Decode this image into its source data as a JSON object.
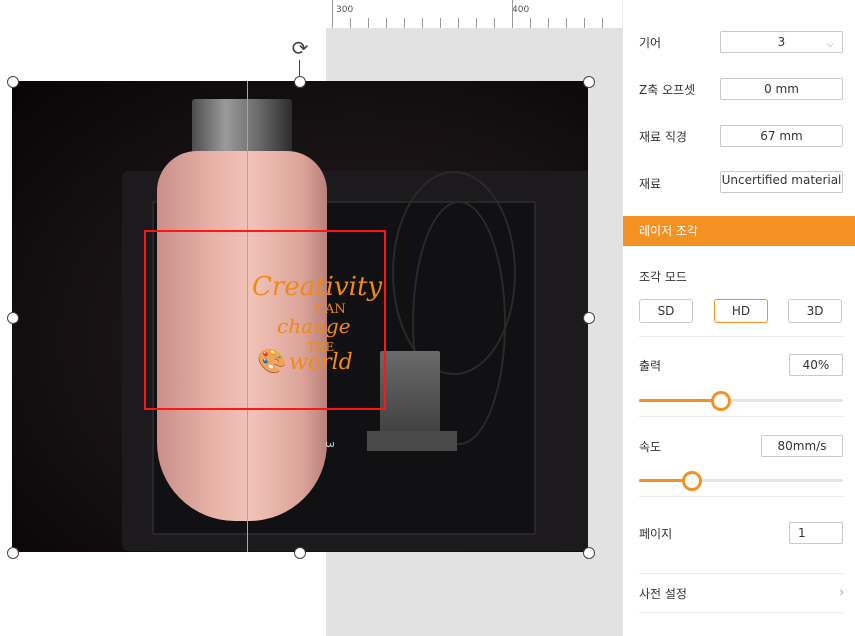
{
  "ruler": {
    "labels": [
      "300",
      "400"
    ]
  },
  "panel": {
    "gear": {
      "label": "기어",
      "value": "3"
    },
    "z_offset": {
      "label": "Z축 오프셋",
      "value": "0 mm"
    },
    "material_diameter": {
      "label": "재료 직경",
      "value": "67 mm"
    },
    "material": {
      "label": "재료",
      "value": "Uncertified material"
    },
    "section": {
      "title": "레이저 조각"
    },
    "engrave_mode": {
      "label": "조각 모드",
      "options": [
        "SD",
        "HD",
        "3D"
      ],
      "selected": "HD"
    },
    "power": {
      "label": "출력",
      "value": "40%",
      "level": 0.4
    },
    "speed": {
      "label": "속도",
      "value": "80mm/s",
      "level": 0.26
    },
    "pass": {
      "label": "페이지",
      "value": "1"
    },
    "presets": {
      "label": "사전 설정"
    }
  },
  "icons": {
    "rotate": "rotate-icon",
    "chevron_down": "chevron-down-icon",
    "chevron_right": "chevron-right-icon"
  },
  "colors": {
    "accent": "#f39223",
    "selection": "#ff1515",
    "center_line": "#e8a020"
  },
  "canvas": {
    "scale_mark": "3"
  },
  "engraving": {
    "l1": "Creativity",
    "l2": "CAN",
    "l3": "change",
    "l4": "THE",
    "l5": "world"
  }
}
